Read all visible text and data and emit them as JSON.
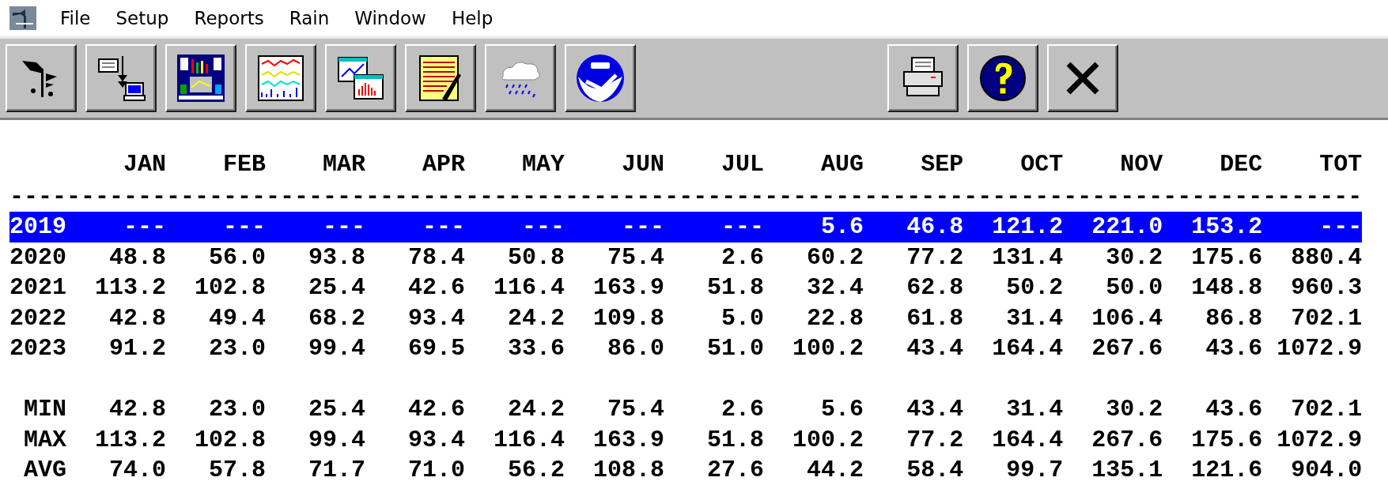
{
  "menu": [
    "File",
    "Setup",
    "Reports",
    "Rain",
    "Window",
    "Help"
  ],
  "table": {
    "columns": [
      "JAN",
      "FEB",
      "MAR",
      "APR",
      "MAY",
      "JUN",
      "JUL",
      "AUG",
      "SEP",
      "OCT",
      "NOV",
      "DEC",
      "TOT"
    ],
    "separator": "-----------------------------------------------------------------------------------------------",
    "rows": [
      {
        "year": "2019",
        "selected": true,
        "values": [
          "---",
          "---",
          "---",
          "---",
          "---",
          "---",
          "---",
          "5.6",
          "46.8",
          "121.2",
          "221.0",
          "153.2",
          "---"
        ]
      },
      {
        "year": "2020",
        "selected": false,
        "values": [
          "48.8",
          "56.0",
          "93.8",
          "78.4",
          "50.8",
          "75.4",
          "2.6",
          "60.2",
          "77.2",
          "131.4",
          "30.2",
          "175.6",
          "880.4"
        ]
      },
      {
        "year": "2021",
        "selected": false,
        "values": [
          "113.2",
          "102.8",
          "25.4",
          "42.6",
          "116.4",
          "163.9",
          "51.8",
          "32.4",
          "62.8",
          "50.2",
          "50.0",
          "148.8",
          "960.3"
        ]
      },
      {
        "year": "2022",
        "selected": false,
        "values": [
          "42.8",
          "49.4",
          "68.2",
          "93.4",
          "24.2",
          "109.8",
          "5.0",
          "22.8",
          "61.8",
          "31.4",
          "106.4",
          "86.8",
          "702.1"
        ]
      },
      {
        "year": "2023",
        "selected": false,
        "values": [
          "91.2",
          "23.0",
          "99.4",
          "69.5",
          "33.6",
          "86.0",
          "51.0",
          "100.2",
          "43.4",
          "164.4",
          "267.6",
          "43.6",
          "1072.9"
        ]
      }
    ],
    "summary": [
      {
        "label": "MIN",
        "values": [
          "42.8",
          "23.0",
          "25.4",
          "42.6",
          "24.2",
          "75.4",
          "2.6",
          "5.6",
          "43.4",
          "31.4",
          "30.2",
          "43.6",
          "702.1"
        ]
      },
      {
        "label": "MAX",
        "values": [
          "113.2",
          "102.8",
          "99.4",
          "93.4",
          "116.4",
          "163.9",
          "51.8",
          "100.2",
          "77.2",
          "164.4",
          "267.6",
          "175.6",
          "1072.9"
        ]
      },
      {
        "label": "AVG",
        "values": [
          "74.0",
          "57.8",
          "71.7",
          "71.0",
          "56.2",
          "108.8",
          "27.6",
          "44.2",
          "58.4",
          "99.7",
          "135.1",
          "121.6",
          "904.0"
        ]
      }
    ]
  }
}
